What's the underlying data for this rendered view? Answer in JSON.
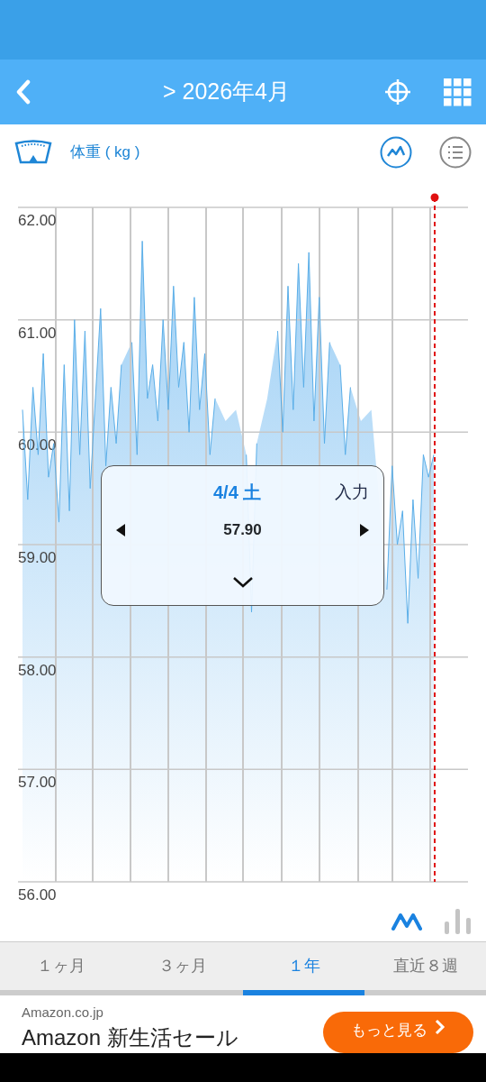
{
  "header": {
    "title": "> 2026年4月"
  },
  "metric": {
    "label": "体重 ( kg )"
  },
  "view_buttons": [
    {
      "kind": "line",
      "selected": true
    },
    {
      "kind": "list",
      "selected": false
    }
  ],
  "chart_data": {
    "type": "area",
    "grid": true,
    "ylim": [
      56,
      62
    ],
    "yticks": [
      {
        "value": 62,
        "label": "62.00"
      },
      {
        "value": 61,
        "label": "61.00"
      },
      {
        "value": 60,
        "label": "60.00"
      },
      {
        "value": 59,
        "label": "59.00"
      },
      {
        "value": 58,
        "label": "58.00"
      },
      {
        "value": 57,
        "label": "57.00"
      },
      {
        "value": 56,
        "label": "56.00"
      }
    ],
    "values": [
      60.2,
      59.4,
      60.4,
      59.8,
      60.7,
      59.6,
      59.9,
      59.2,
      60.6,
      59.3,
      61.0,
      59.8,
      60.9,
      59.5,
      60.3,
      61.1,
      59.7,
      60.4,
      59.9,
      60.6,
      null,
      60.8,
      59.8,
      61.7,
      60.3,
      60.6,
      60.1,
      61.0,
      60.2,
      61.3,
      60.4,
      60.8,
      60.0,
      61.2,
      60.2,
      60.7,
      59.8,
      60.3,
      null,
      60.1,
      null,
      60.2,
      null,
      59.8,
      58.4,
      59.9,
      null,
      60.3,
      null,
      60.9,
      60.0,
      61.3,
      60.2,
      61.5,
      60.4,
      61.6,
      60.1,
      61.2,
      59.9,
      60.8,
      null,
      60.6,
      59.8,
      60.4,
      null,
      60.1,
      null,
      60.2,
      null,
      null,
      58.6,
      59.7,
      59.0,
      59.3,
      58.3,
      59.4,
      58.7,
      59.8,
      59.6,
      59.8
    ]
  },
  "popup": {
    "date": "4/4 土",
    "value": "57.90",
    "action": "入力"
  },
  "chart_types": [
    {
      "kind": "line",
      "selected": true
    },
    {
      "kind": "bar",
      "selected": false
    }
  ],
  "tabs": [
    {
      "label": "１ヶ月",
      "selected": false
    },
    {
      "label": "３ヶ月",
      "selected": false
    },
    {
      "label": "１年",
      "selected": true
    },
    {
      "label": "直近８週",
      "selected": false
    }
  ],
  "ad": {
    "source": "Amazon.co.jp",
    "headline": "Amazon 新生活セール",
    "button": "もっと見る"
  }
}
